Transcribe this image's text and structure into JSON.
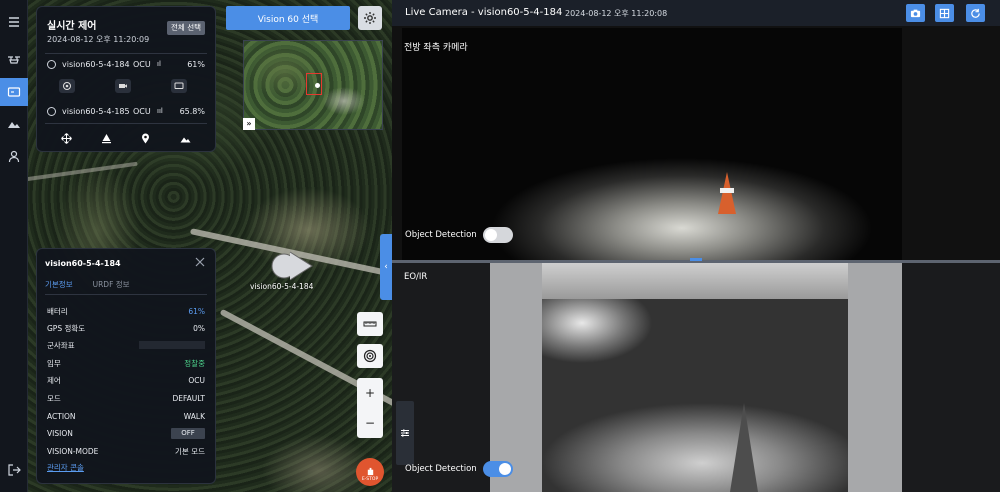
{
  "rail": {
    "icons": [
      "menu-icon",
      "drone-icon",
      "camera-monitor-icon",
      "mountain-icon",
      "user-icon",
      "logout-icon"
    ]
  },
  "realtime": {
    "title": "실시간 제어",
    "timestamp": "2024-08-12 오후 11:20:09",
    "select_all": "전체 선택",
    "robots": [
      {
        "name": "vision60-5-4-184",
        "mode": "OCU",
        "signal": "ıl",
        "battery": "61%"
      },
      {
        "name": "vision60-5-4-185",
        "mode": "OCU",
        "signal": "ııl",
        "battery": "65.8%"
      }
    ]
  },
  "map": {
    "vision_select": "Vision 60 선택",
    "minimap_expand": "»",
    "robot_label": "vision60-5-4-184",
    "side_tab": "‹",
    "zoom_in": "+",
    "zoom_out": "−",
    "estop": "E-STOP"
  },
  "info": {
    "robot": "vision60-5-4-184",
    "tabs": [
      "기본정보",
      "URDF 정보"
    ],
    "rows": [
      {
        "label": "배터리",
        "value": "61%"
      },
      {
        "label": "GPS 정확도",
        "value": "0%"
      },
      {
        "label": "군사좌표",
        "value": ""
      },
      {
        "label": "임무",
        "value": "정찰중"
      },
      {
        "label": "제어",
        "value": "OCU"
      },
      {
        "label": "모드",
        "value": "DEFAULT"
      },
      {
        "label": "ACTION",
        "value": "WALK"
      },
      {
        "label": "VISION",
        "value": "OFF"
      },
      {
        "label": "VISION-MODE",
        "value": "기본 모드"
      }
    ],
    "admin_link": "관리자 콘솔"
  },
  "camera": {
    "title": "Live Camera - vision60-5-4-184",
    "timestamp": "2024-08-12 오후 11:20:08",
    "feeds": [
      {
        "label": "전방 좌측 카메라",
        "object_detection": "Object Detection",
        "od_enabled": false
      },
      {
        "label": "EO/IR",
        "object_detection": "Object Detection",
        "od_enabled": true
      }
    ]
  },
  "colors": {
    "accent": "#4b8ee6",
    "estop": "#e0552f",
    "ok": "#4cd08a"
  }
}
